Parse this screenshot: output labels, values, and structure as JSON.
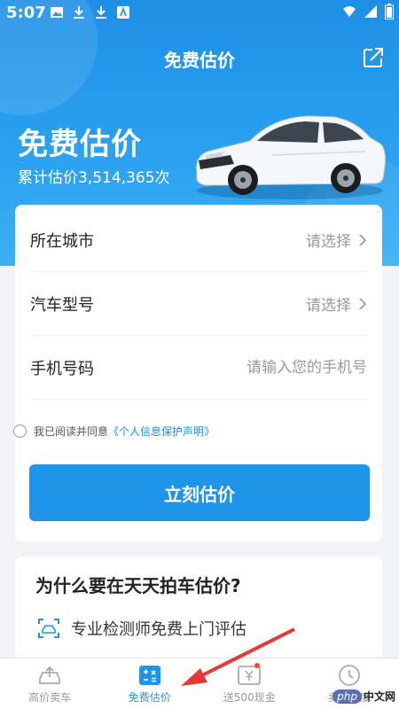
{
  "status": {
    "time": "5:07"
  },
  "header": {
    "title": "免费估价"
  },
  "promo": {
    "title": "免费估价",
    "count_prefix": "累计估价",
    "count": "3,514,365",
    "count_suffix": "次"
  },
  "form": {
    "rows": [
      {
        "label": "所在城市",
        "value": "请选择"
      },
      {
        "label": "汽车型号",
        "value": "请选择"
      },
      {
        "label": "手机号码",
        "placeholder": "请输入您的手机号"
      }
    ],
    "agree_text": "我已阅读并同意",
    "agree_link": "《个人信息保护声明》",
    "submit_label": "立刻估价"
  },
  "why": {
    "title": "为什么要在天天拍车估价?",
    "items": [
      {
        "text": "专业检测师免费上门评估"
      }
    ]
  },
  "tabs": [
    {
      "label": "高价卖车",
      "icon": "car-upload-icon"
    },
    {
      "label": "免费估价",
      "icon": "valuation-icon",
      "active": true
    },
    {
      "label": "送500现金",
      "icon": "cash-voucher-icon"
    },
    {
      "label": "卖车进度",
      "icon": "clock-icon"
    }
  ],
  "watermark": {
    "logo": "php",
    "text": "中文网"
  },
  "colors": {
    "primary": "#1e95e8",
    "hero": "#2aa0ef",
    "badge": "#e8463a",
    "annotation_arrow": "#e53935"
  }
}
